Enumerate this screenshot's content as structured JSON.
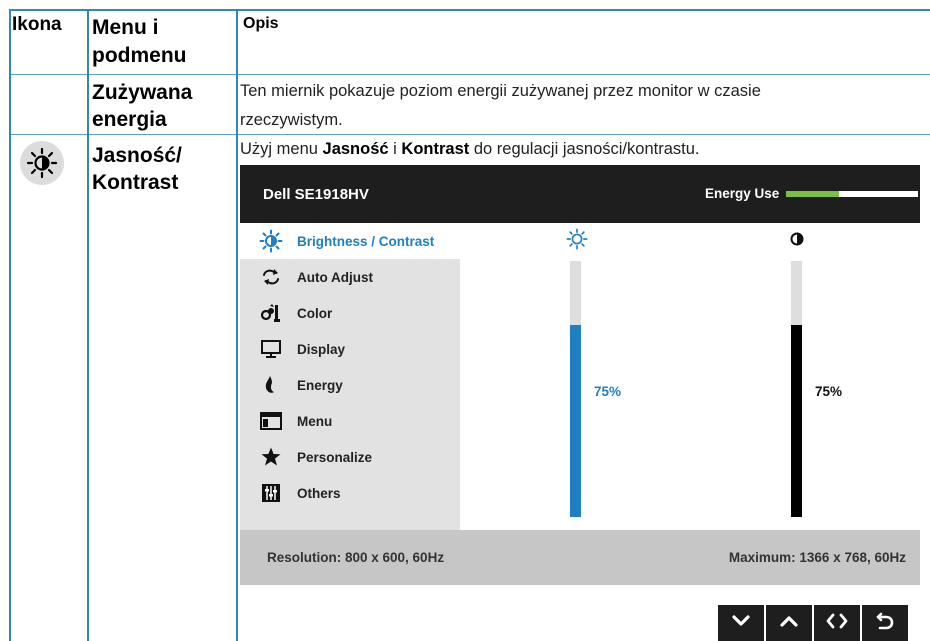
{
  "table": {
    "headers": {
      "icon": "Ikona",
      "menu_line1": "Menu i",
      "menu_line2": "podmenu",
      "description": "Opis"
    },
    "rows": [
      {
        "menu_line1": "Zużywana",
        "menu_line2": "energia",
        "desc_line1": "Ten miernik pokazuje poziom energii zużywanej przez monitor w czasie",
        "desc_line2": "rzeczywistym."
      },
      {
        "icon": "brightness-icon",
        "menu_line1": "Jasność/",
        "menu_line2": "Kontrast",
        "desc_part1": "Użyj menu ",
        "desc_bold1": "Jasność",
        "desc_part2": " i ",
        "desc_bold2": "Kontrast",
        "desc_part3": " do regulacji jasności/kontrastu."
      }
    ]
  },
  "osd": {
    "model": "Dell SE1918HV",
    "energy_label": "Energy Use",
    "energy_level": 0.4,
    "menu_items": [
      {
        "label": "Brightness / Contrast",
        "icon": "brightness-icon",
        "active": true
      },
      {
        "label": "Auto Adjust",
        "icon": "auto-adjust-icon",
        "active": false
      },
      {
        "label": "Color",
        "icon": "color-icon",
        "active": false
      },
      {
        "label": "Display",
        "icon": "display-icon",
        "active": false
      },
      {
        "label": "Energy",
        "icon": "energy-icon",
        "active": false
      },
      {
        "label": "Menu",
        "icon": "menu-icon",
        "active": false
      },
      {
        "label": "Personalize",
        "icon": "star-icon",
        "active": false
      },
      {
        "label": "Others",
        "icon": "others-icon",
        "active": false
      }
    ],
    "brightness": {
      "icon": "brightness-icon",
      "value": 75,
      "label": "75%",
      "color": "#1e7fc2"
    },
    "contrast": {
      "icon": "contrast-icon",
      "value": 75,
      "label": "75%",
      "color": "#000000"
    },
    "resolution": "Resolution: 800 x 600, 60Hz",
    "maximum": "Maximum: 1366 x 768, 60Hz"
  },
  "nav_buttons": [
    {
      "icon": "chevron-down-icon"
    },
    {
      "icon": "chevron-up-icon"
    },
    {
      "icon": "left-right-icon"
    },
    {
      "icon": "back-icon"
    }
  ],
  "colors": {
    "table_border": "#2e87c4",
    "accent": "#1e7fc2",
    "energy_fill": "#7ac043"
  }
}
